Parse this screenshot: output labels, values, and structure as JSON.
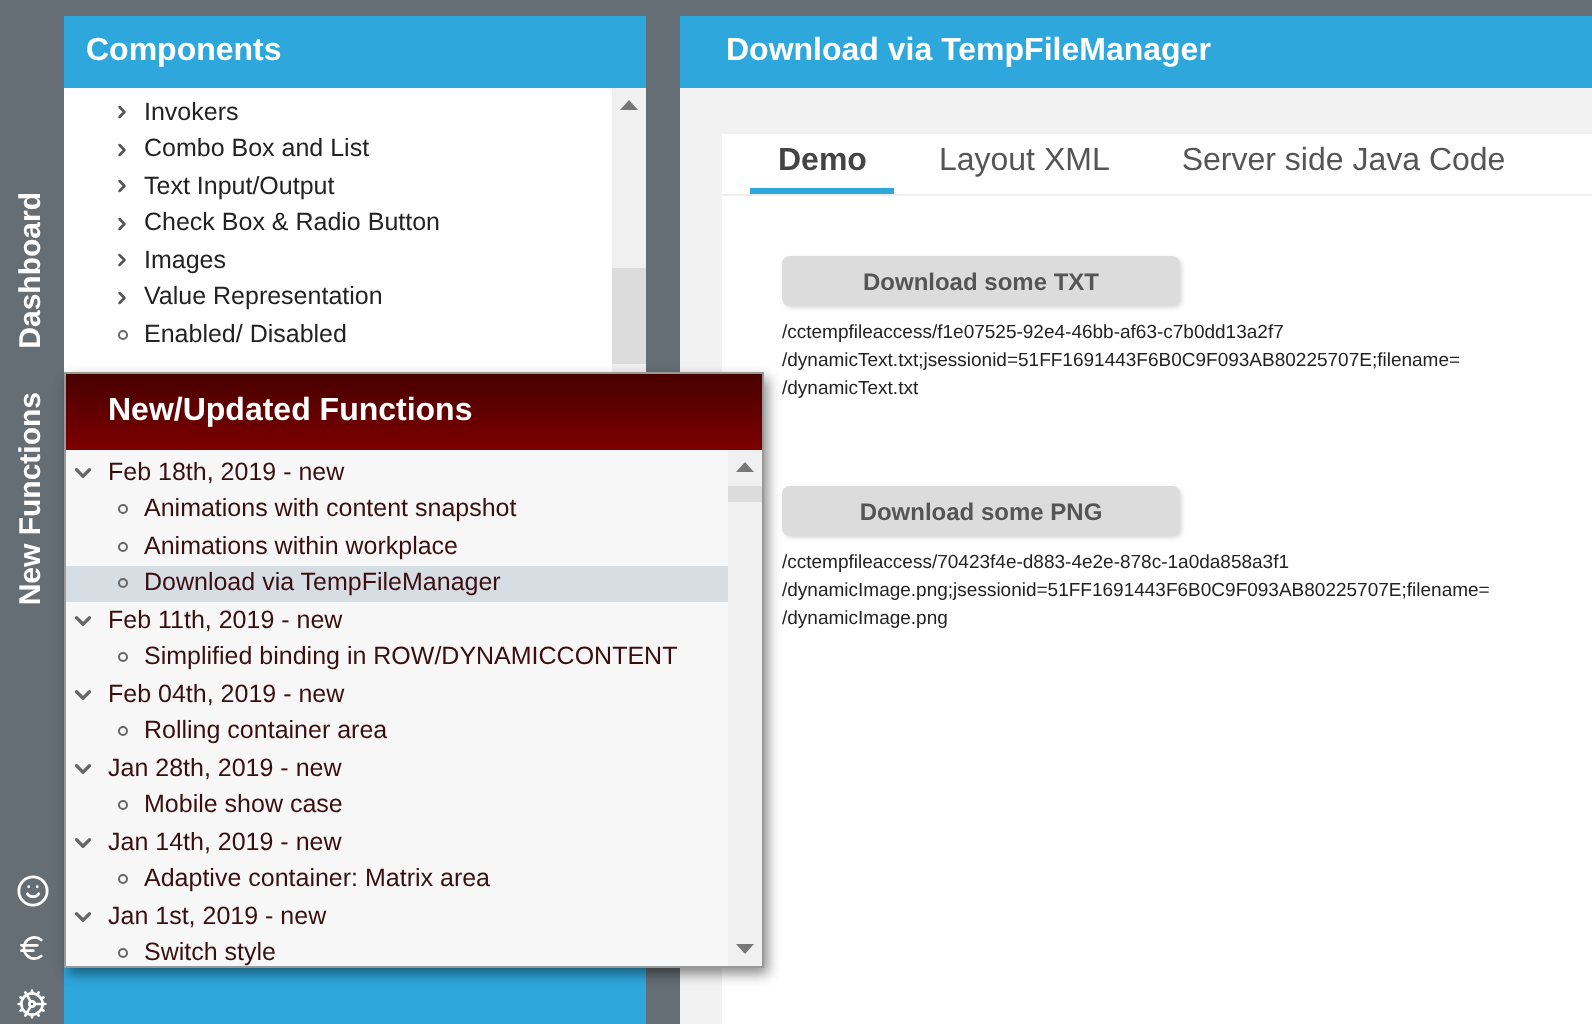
{
  "rail": {
    "items": [
      {
        "label": "Dashboard"
      },
      {
        "label": "New Functions"
      }
    ]
  },
  "components": {
    "title": "Components",
    "items": [
      {
        "label": "Invokers",
        "kind": "folder"
      },
      {
        "label": "Combo Box and List",
        "kind": "folder"
      },
      {
        "label": "Text Input/Output",
        "kind": "folder"
      },
      {
        "label": "Check Box & Radio Button",
        "kind": "folder"
      },
      {
        "label": "Images",
        "kind": "folder"
      },
      {
        "label": "Value Representation",
        "kind": "folder"
      },
      {
        "label": "Enabled/ Disabled",
        "kind": "leaf"
      }
    ]
  },
  "popup": {
    "title": "New/Updated Functions",
    "groups": [
      {
        "label": "Feb 18th, 2019 - new",
        "expanded": true,
        "children": [
          {
            "label": "Animations with content snapshot",
            "selected": false
          },
          {
            "label": "Animations within workplace",
            "selected": false
          },
          {
            "label": "Download via TempFileManager",
            "selected": true
          }
        ]
      },
      {
        "label": "Feb 11th, 2019 - new",
        "expanded": true,
        "children": [
          {
            "label": "Simplified binding in ROW/DYNAMICCONTENT",
            "selected": false
          }
        ]
      },
      {
        "label": "Feb 04th, 2019 - new",
        "expanded": true,
        "children": [
          {
            "label": "Rolling container area",
            "selected": false
          }
        ]
      },
      {
        "label": "Jan 28th, 2019 - new",
        "expanded": true,
        "children": [
          {
            "label": "Mobile show case",
            "selected": false
          }
        ]
      },
      {
        "label": "Jan 14th, 2019 - new",
        "expanded": true,
        "children": [
          {
            "label": "Adaptive container: Matrix area",
            "selected": false
          }
        ]
      },
      {
        "label": "Jan 1st, 2019 - new",
        "expanded": true,
        "children": [
          {
            "label": "Switch style",
            "selected": false
          }
        ]
      }
    ]
  },
  "main": {
    "title": "Download via TempFileManager",
    "tabs": [
      {
        "label": "Demo",
        "selected": true
      },
      {
        "label": "Layout XML",
        "selected": false
      },
      {
        "label": "Server side Java Code",
        "selected": false
      }
    ],
    "downloads": [
      {
        "button": "Download some TXT",
        "path_lines": [
          "/cctempfileaccess/f1e07525-92e4-46bb-af63-c7b0dd13a2f7",
          "/dynamicText.txt;jsessionid=51FF1691443F6B0C9F093AB80225707E;filename=",
          "/dynamicText.txt"
        ]
      },
      {
        "button": "Download some PNG",
        "path_lines": [
          "/cctempfileaccess/70423f4e-d883-4e2e-878c-1a0da858a3f1",
          "/dynamicImage.png;jsessionid=51FF1691443F6B0C9F093AB80225707E;filename=",
          "/dynamicImage.png"
        ]
      }
    ]
  }
}
